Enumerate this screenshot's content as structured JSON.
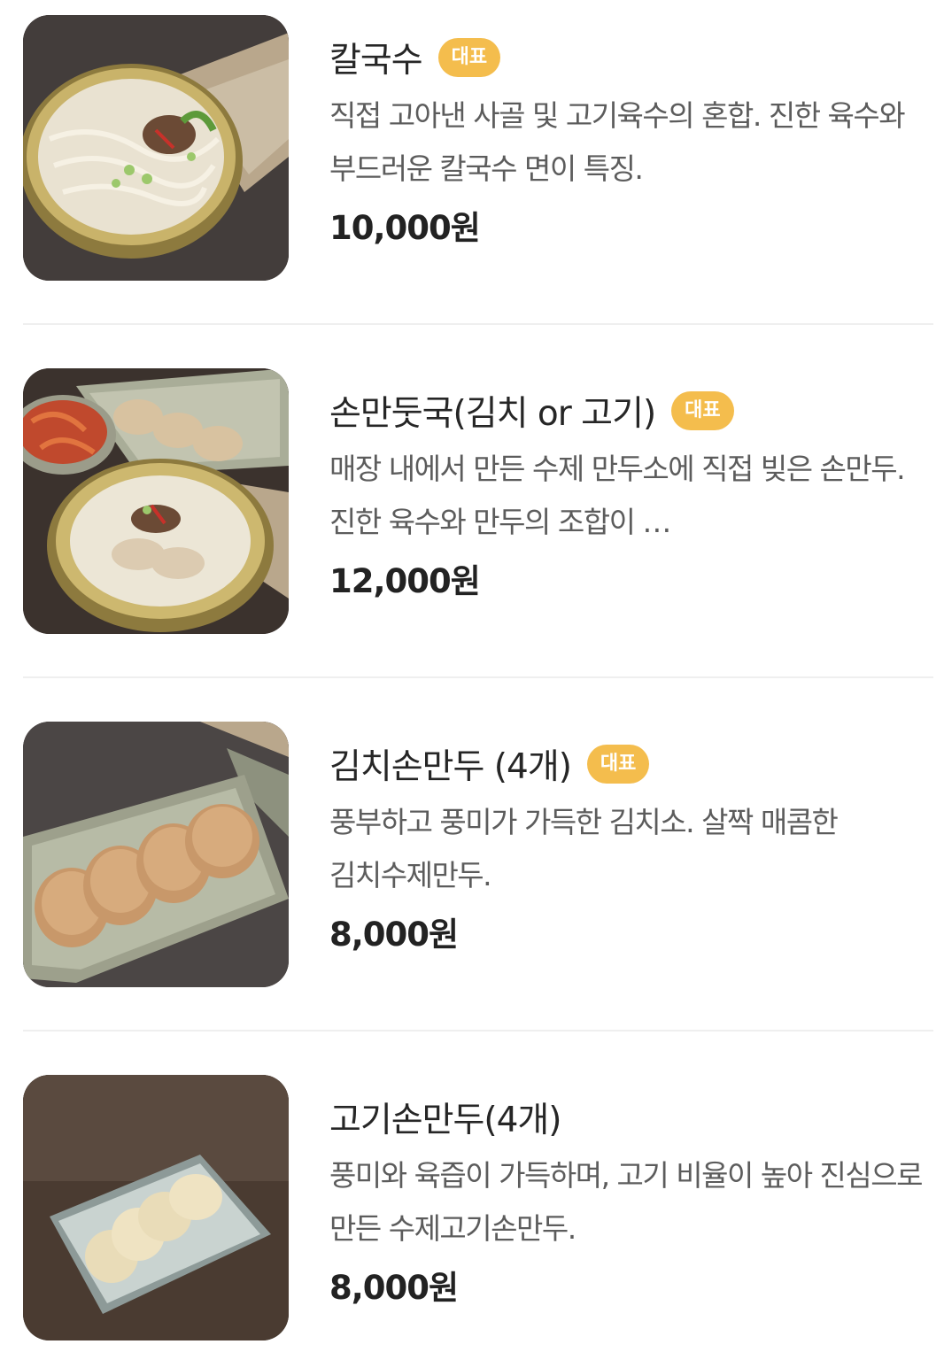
{
  "menu": {
    "items": [
      {
        "name": "칼국수",
        "badge": "대표",
        "description": "직접 고아낸 사골 및 고기육수의 혼합. 진한 육수와 부드러운 칼국수 면이 특징.",
        "price": "10,000원"
      },
      {
        "name": "손만둣국(김치 or 고기)",
        "badge": "대표",
        "description": "매장 내에서 만든 수제 만두소에 직접 빚은 손만두. 진한 육수와 만두의 조합이 …",
        "price": "12,000원"
      },
      {
        "name": "김치손만두 (4개)",
        "badge": "대표",
        "description": "풍부하고 풍미가 가득한 김치소. 살짝 매콤한 김치수제만두.",
        "price": "8,000원"
      },
      {
        "name": "고기손만두(4개)",
        "description": "풍미와 육즙이 가득하며, 고기 비율이 높아 진심으로 만든 수제고기손만두.",
        "price": "8,000원"
      }
    ]
  },
  "colors": {
    "badge": "#f4bd4d",
    "divider": "#efefef",
    "price": "#222222",
    "description": "#5c5c5c"
  }
}
